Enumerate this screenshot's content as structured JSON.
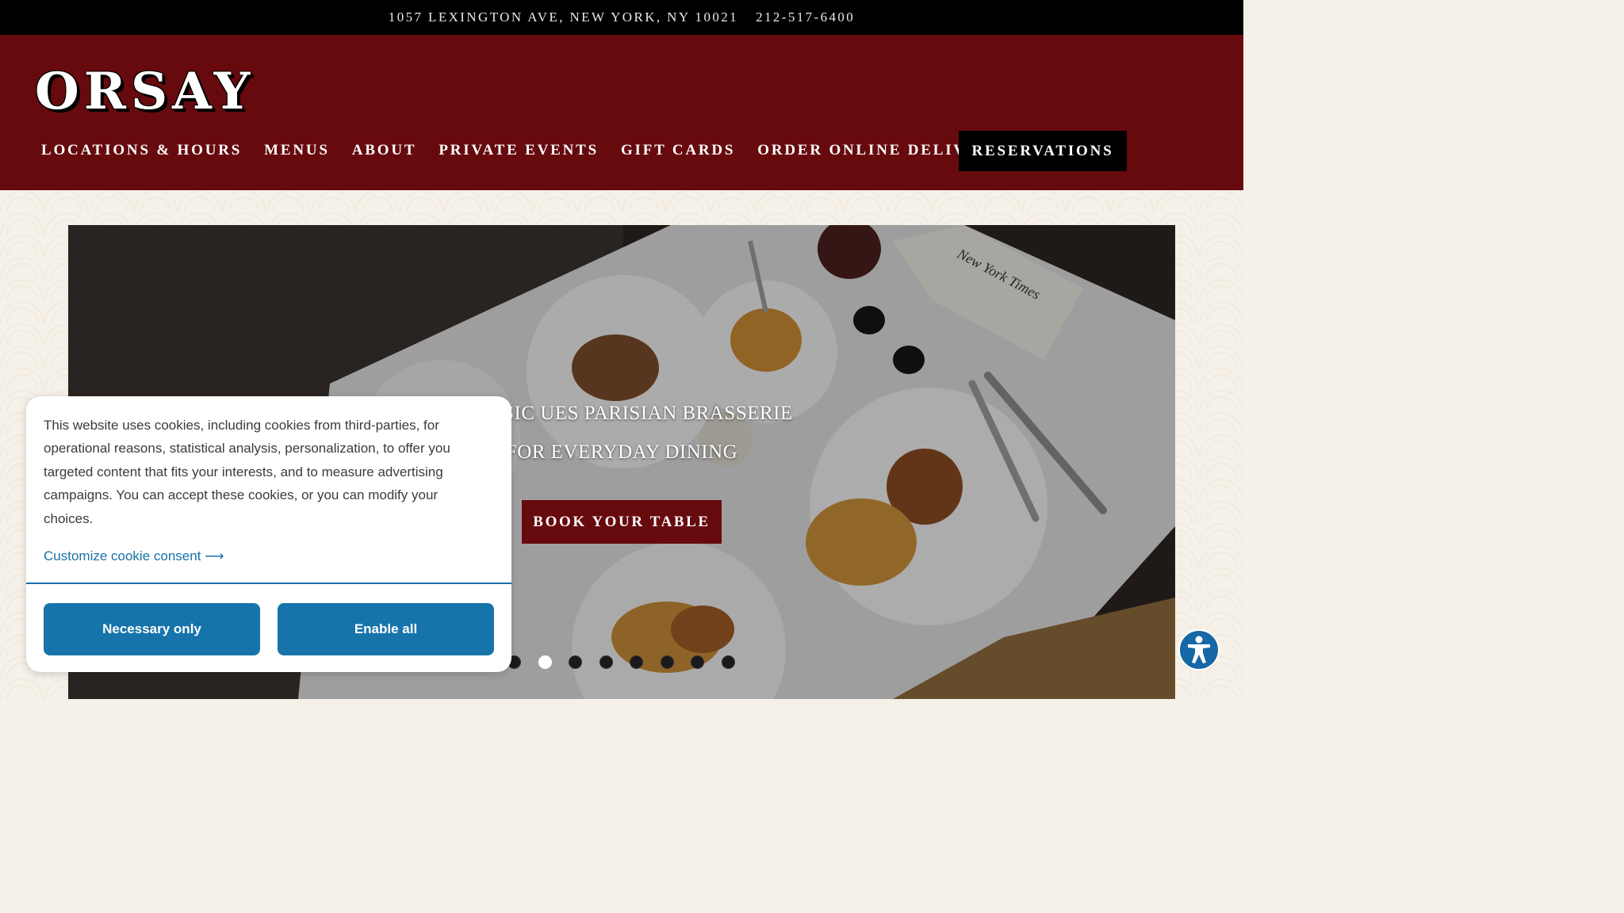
{
  "topbar": {
    "address": "1057 LEXINGTON AVE, NEW YORK, NY 10021",
    "phone": "212-517-6400"
  },
  "header": {
    "logo": "ORSAY",
    "nav": [
      {
        "label": "LOCATIONS & HOURS"
      },
      {
        "label": "MENUS"
      },
      {
        "label": "ABOUT"
      },
      {
        "label": "PRIVATE EVENTS"
      },
      {
        "label": "GIFT CARDS"
      },
      {
        "label": "ORDER ONLINE DELIVERY"
      }
    ],
    "reservations_label": "RESERVATIONS",
    "brand_color": "#660a0e"
  },
  "hero": {
    "line1": "CLASSIC UES PARISIAN BRASSERIE",
    "line2": "FOR EVERYDAY DINING",
    "cta_label": "BOOK YOUR TABLE",
    "newspaper_text": "New York Times",
    "slides_total": 8,
    "active_slide": 2
  },
  "cookie_banner": {
    "message": "This website uses cookies, including cookies from third-parties, for operational reasons, statistical analysis, personalization, to offer you targeted content that fits your interests, and to measure advertising campaigns. You can accept these cookies, or you can modify your choices.",
    "customize_link": "Customize cookie consent",
    "necessary_label": "Necessary only",
    "enable_label": "Enable all",
    "accent_color": "#1774ab"
  },
  "accessibility": {
    "icon": "accessibility-icon"
  }
}
